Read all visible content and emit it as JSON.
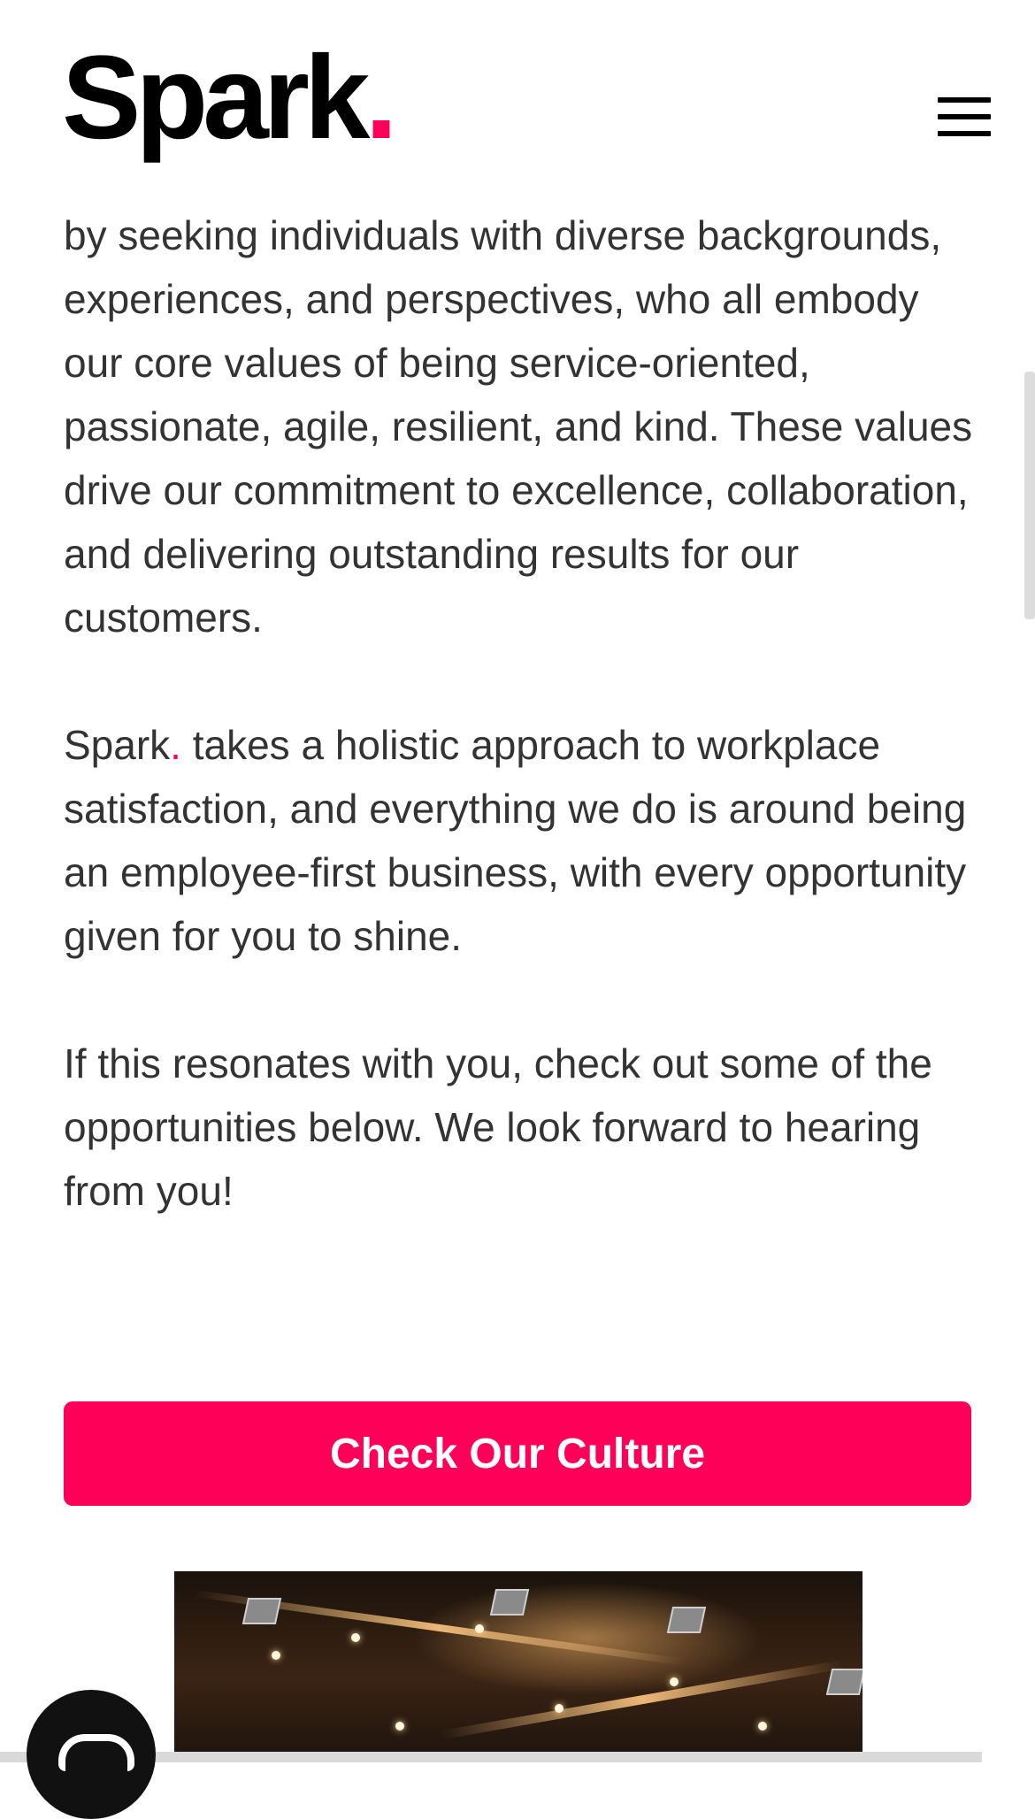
{
  "header": {
    "logo_text": "Spark",
    "logo_dot": "."
  },
  "content": {
    "paragraph1": "by seeking individuals with diverse backgrounds, experiences, and perspectives, who all embody our core values of being service-oriented, passionate, agile, resilient, and kind. These values drive our commitment to excellence, collaboration, and delivering outstanding results for our customers.",
    "paragraph2_brand": "Spark",
    "paragraph2_dot": ".",
    "paragraph2_rest": " takes a holistic approach to workplace satisfaction, and everything we do is around being an employee-first business, with every opportunity given for you to shine.",
    "paragraph3": "If this resonates with you, check out some of the opportunities below. We look forward to hearing from you!"
  },
  "cta": {
    "label": "Check Our Culture"
  },
  "colors": {
    "accent": "#ff0059",
    "text": "#333333",
    "logo": "#000000"
  },
  "icons": {
    "menu": "hamburger-menu-icon",
    "chat": "chat-icon"
  }
}
